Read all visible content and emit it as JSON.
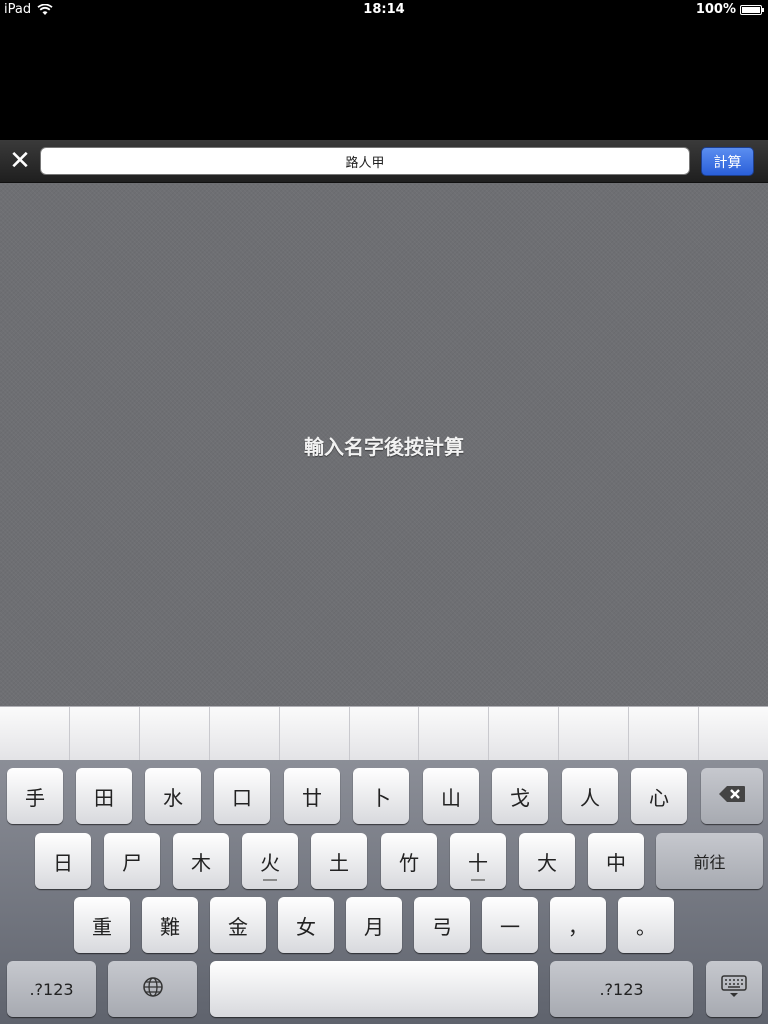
{
  "status_bar": {
    "device": "iPad",
    "time": "18:14",
    "battery": "100%"
  },
  "toolbar": {
    "close_icon": "close-icon",
    "input_value": "路人甲",
    "calc_label": "計算"
  },
  "content": {
    "hint": "輸入名字後按計算"
  },
  "candidates": {
    "count": 11
  },
  "keyboard": {
    "row1": [
      "手",
      "田",
      "水",
      "口",
      "廿",
      "卜",
      "山",
      "戈",
      "人",
      "心"
    ],
    "row2": [
      "日",
      "尸",
      "木",
      "火",
      "土",
      "竹",
      "十",
      "大",
      "中"
    ],
    "row2_return": "前往",
    "row3": [
      "重",
      "難",
      "金",
      "女",
      "月",
      "弓",
      "一",
      "，",
      "。"
    ],
    "row4": {
      "left_mode": ".?123",
      "right_mode": ".?123"
    },
    "icons": {
      "backspace": "backspace-icon",
      "globe": "globe-icon",
      "hide_keyboard": "keyboard-hide-icon"
    }
  }
}
